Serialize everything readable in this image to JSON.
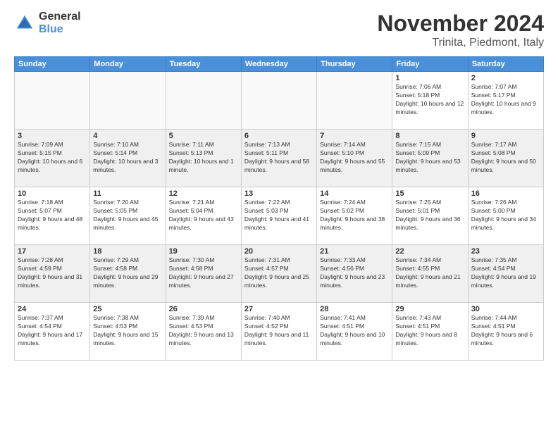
{
  "logo": {
    "general": "General",
    "blue": "Blue"
  },
  "title": "November 2024",
  "location": "Trinita, Piedmont, Italy",
  "weekdays": [
    "Sunday",
    "Monday",
    "Tuesday",
    "Wednesday",
    "Thursday",
    "Friday",
    "Saturday"
  ],
  "weeks": [
    [
      {
        "day": "",
        "info": ""
      },
      {
        "day": "",
        "info": ""
      },
      {
        "day": "",
        "info": ""
      },
      {
        "day": "",
        "info": ""
      },
      {
        "day": "",
        "info": ""
      },
      {
        "day": "1",
        "info": "Sunrise: 7:06 AM\nSunset: 5:18 PM\nDaylight: 10 hours and 12 minutes."
      },
      {
        "day": "2",
        "info": "Sunrise: 7:07 AM\nSunset: 5:17 PM\nDaylight: 10 hours and 9 minutes."
      }
    ],
    [
      {
        "day": "3",
        "info": "Sunrise: 7:09 AM\nSunset: 5:15 PM\nDaylight: 10 hours and 6 minutes."
      },
      {
        "day": "4",
        "info": "Sunrise: 7:10 AM\nSunset: 5:14 PM\nDaylight: 10 hours and 3 minutes."
      },
      {
        "day": "5",
        "info": "Sunrise: 7:11 AM\nSunset: 5:13 PM\nDaylight: 10 hours and 1 minute."
      },
      {
        "day": "6",
        "info": "Sunrise: 7:13 AM\nSunset: 5:11 PM\nDaylight: 9 hours and 58 minutes."
      },
      {
        "day": "7",
        "info": "Sunrise: 7:14 AM\nSunset: 5:10 PM\nDaylight: 9 hours and 55 minutes."
      },
      {
        "day": "8",
        "info": "Sunrise: 7:15 AM\nSunset: 5:09 PM\nDaylight: 9 hours and 53 minutes."
      },
      {
        "day": "9",
        "info": "Sunrise: 7:17 AM\nSunset: 5:08 PM\nDaylight: 9 hours and 50 minutes."
      }
    ],
    [
      {
        "day": "10",
        "info": "Sunrise: 7:18 AM\nSunset: 5:07 PM\nDaylight: 9 hours and 48 minutes."
      },
      {
        "day": "11",
        "info": "Sunrise: 7:20 AM\nSunset: 5:05 PM\nDaylight: 9 hours and 45 minutes."
      },
      {
        "day": "12",
        "info": "Sunrise: 7:21 AM\nSunset: 5:04 PM\nDaylight: 9 hours and 43 minutes."
      },
      {
        "day": "13",
        "info": "Sunrise: 7:22 AM\nSunset: 5:03 PM\nDaylight: 9 hours and 41 minutes."
      },
      {
        "day": "14",
        "info": "Sunrise: 7:24 AM\nSunset: 5:02 PM\nDaylight: 9 hours and 38 minutes."
      },
      {
        "day": "15",
        "info": "Sunrise: 7:25 AM\nSunset: 5:01 PM\nDaylight: 9 hours and 36 minutes."
      },
      {
        "day": "16",
        "info": "Sunrise: 7:26 AM\nSunset: 5:00 PM\nDaylight: 9 hours and 34 minutes."
      }
    ],
    [
      {
        "day": "17",
        "info": "Sunrise: 7:28 AM\nSunset: 4:59 PM\nDaylight: 9 hours and 31 minutes."
      },
      {
        "day": "18",
        "info": "Sunrise: 7:29 AM\nSunset: 4:58 PM\nDaylight: 9 hours and 29 minutes."
      },
      {
        "day": "19",
        "info": "Sunrise: 7:30 AM\nSunset: 4:58 PM\nDaylight: 9 hours and 27 minutes."
      },
      {
        "day": "20",
        "info": "Sunrise: 7:31 AM\nSunset: 4:57 PM\nDaylight: 9 hours and 25 minutes."
      },
      {
        "day": "21",
        "info": "Sunrise: 7:33 AM\nSunset: 4:56 PM\nDaylight: 9 hours and 23 minutes."
      },
      {
        "day": "22",
        "info": "Sunrise: 7:34 AM\nSunset: 4:55 PM\nDaylight: 9 hours and 21 minutes."
      },
      {
        "day": "23",
        "info": "Sunrise: 7:35 AM\nSunset: 4:54 PM\nDaylight: 9 hours and 19 minutes."
      }
    ],
    [
      {
        "day": "24",
        "info": "Sunrise: 7:37 AM\nSunset: 4:54 PM\nDaylight: 9 hours and 17 minutes."
      },
      {
        "day": "25",
        "info": "Sunrise: 7:38 AM\nSunset: 4:53 PM\nDaylight: 9 hours and 15 minutes."
      },
      {
        "day": "26",
        "info": "Sunrise: 7:39 AM\nSunset: 4:53 PM\nDaylight: 9 hours and 13 minutes."
      },
      {
        "day": "27",
        "info": "Sunrise: 7:40 AM\nSunset: 4:52 PM\nDaylight: 9 hours and 11 minutes."
      },
      {
        "day": "28",
        "info": "Sunrise: 7:41 AM\nSunset: 4:51 PM\nDaylight: 9 hours and 10 minutes."
      },
      {
        "day": "29",
        "info": "Sunrise: 7:43 AM\nSunset: 4:51 PM\nDaylight: 9 hours and 8 minutes."
      },
      {
        "day": "30",
        "info": "Sunrise: 7:44 AM\nSunset: 4:51 PM\nDaylight: 9 hours and 6 minutes."
      }
    ]
  ]
}
